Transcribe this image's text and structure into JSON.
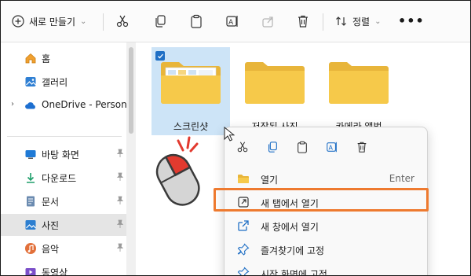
{
  "toolbar": {
    "new_label": "새로 만들기",
    "sort_label": "정렬",
    "more_label": "•••"
  },
  "sidebar": {
    "items": [
      {
        "label": "홈",
        "icon": "home-icon"
      },
      {
        "label": "갤러리",
        "icon": "gallery-icon"
      },
      {
        "label": "OneDrive - Personal",
        "icon": "cloud-icon"
      },
      {
        "label": "바탕 화면",
        "icon": "desktop-icon"
      },
      {
        "label": "다운로드",
        "icon": "download-icon"
      },
      {
        "label": "문서",
        "icon": "document-icon"
      },
      {
        "label": "사진",
        "icon": "pictures-icon"
      },
      {
        "label": "음악",
        "icon": "music-icon"
      },
      {
        "label": "동영상",
        "icon": "video-icon"
      }
    ]
  },
  "folders": [
    {
      "name": "스크린샷"
    },
    {
      "name": "저장된 사진"
    },
    {
      "name": "카메라 앨범"
    }
  ],
  "context_menu": {
    "items": [
      {
        "label": "열기",
        "shortcut": "Enter"
      },
      {
        "label": "새 탭에서 열기"
      },
      {
        "label": "새 창에서 열기"
      },
      {
        "label": "즐겨찾기에 고정"
      },
      {
        "label": "시작 화면에 고정"
      }
    ]
  },
  "colors": {
    "accent": "#1f6fc5",
    "highlight": "#ee7a2f",
    "folder": "#f6c94a",
    "selection": "#cde4f7"
  }
}
